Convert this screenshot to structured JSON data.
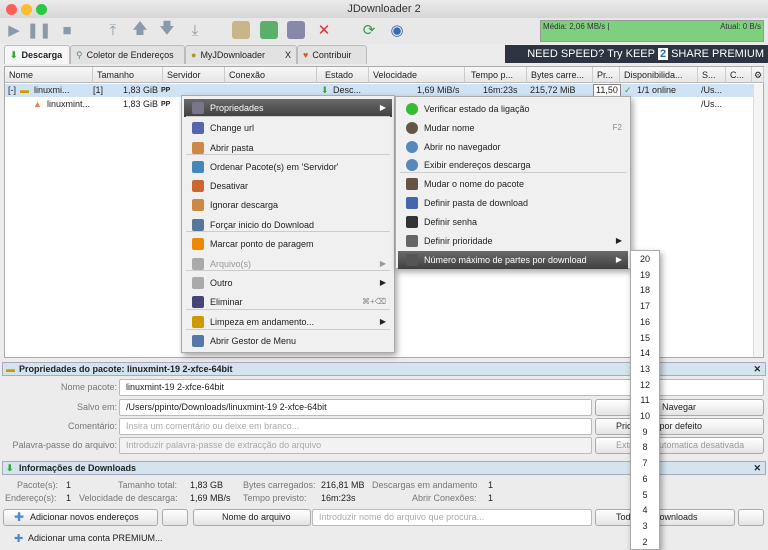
{
  "window": {
    "title": "JDownloader 2"
  },
  "speed": {
    "average": "Média: 2,06 MB/s |",
    "current": "Atual: 0 B/s"
  },
  "tabs": [
    {
      "label": "Descarga"
    },
    {
      "label": "Coletor de Endereços"
    },
    {
      "label": "MyJDownloader",
      "close": "X"
    },
    {
      "label": "Contribuir"
    }
  ],
  "promo": {
    "a": "NEED SPEED? Try KEEP",
    "b": "2",
    "c": "SHARE PREMIUM"
  },
  "table": {
    "headers": [
      "Nome",
      "Tamanho",
      "Servidor",
      "Conexão",
      "Estado",
      "Velocidade",
      "Tempo p...",
      "Bytes carre...",
      "Pr...",
      "Disponibilida...",
      "S...",
      "C..."
    ],
    "rows": [
      {
        "expander": "[-]",
        "name": "linuxmi...",
        "count": "[1]",
        "size": "1,83 GiB",
        "host": "PP",
        "status": "Desc...",
        "speed": "1,69 MiB/s",
        "eta": "16m:23s",
        "loaded": "215,72 MiB",
        "priority": "11,50",
        "availability": "1/1 online",
        "path": "/Us..."
      },
      {
        "name": "linuxmint...",
        "size": "1,83 GiB",
        "host": "PP",
        "path": "/Us..."
      }
    ]
  },
  "context_menu": {
    "items": [
      {
        "label": "Propriedades",
        "submenu": true
      },
      {
        "label": "Change url"
      },
      {
        "label": "Abrir pasta"
      },
      {
        "label": "Ordenar Pacote(s) em 'Servidor'"
      },
      {
        "label": "Desativar"
      },
      {
        "label": "Ignorar descarga"
      },
      {
        "label": "Forçar inicio do Download"
      },
      {
        "label": "Marcar ponto de paragem"
      },
      {
        "label": "Arquivo(s)",
        "submenu": true
      },
      {
        "label": "Outro",
        "submenu": true
      },
      {
        "label": "Eliminar",
        "shortcut": "⌘+⌫"
      },
      {
        "label": "Limpeza em andamento...",
        "submenu": true
      },
      {
        "label": "Abrir Gestor de Menu"
      }
    ]
  },
  "properties_submenu": {
    "items": [
      {
        "label": "Verificar estado da ligação"
      },
      {
        "label": "Mudar nome",
        "shortcut": "F2"
      },
      {
        "label": "Abrir no navegador"
      },
      {
        "label": "Exibir endereços descarga"
      },
      {
        "label": "Mudar o nome do pacote"
      },
      {
        "label": "Definir pasta de download"
      },
      {
        "label": "Definir senha"
      },
      {
        "label": "Definir prioridade"
      },
      {
        "label": "Número máximo de partes por download"
      }
    ]
  },
  "chunks_submenu": {
    "items": [
      "20",
      "19",
      "18",
      "17",
      "16",
      "15",
      "14",
      "13",
      "12",
      "11",
      "10",
      "9",
      "8",
      "7",
      "6",
      "5",
      "4",
      "3",
      "2"
    ]
  },
  "package_panel": {
    "title": "Propriedades do pacote: linuxmint-19 2-xfce-64bit",
    "name_label": "Nome pacote:",
    "name_value": "linuxmint-19 2-xfce-64bit",
    "saveto_label": "Salvo em:",
    "saveto_value": "/Users/ppinto/Downloads/linuxmint-19 2-xfce-64bit",
    "browse": "Navegar",
    "comment_label": "Comentário:",
    "comment_placeholder": "Insira um comentário ou deixe em branco...",
    "priority": "Prioridade por defeito",
    "password_label": "Palavra-passe do arquivo:",
    "password_placeholder": "Introduzir palavra-passe de extracção do arquivo",
    "extract": "Extração automatica desativada"
  },
  "info_panel": {
    "title": "Informações de Downloads",
    "packages_label": "Pacote(s):",
    "packages": "1",
    "total_label": "Tamanho total:",
    "total": "1,83 GB",
    "loaded_label": "Bytes carregados:",
    "loaded": "216,81 MB",
    "running_label": "Descargas em andamento",
    "running": "1",
    "links_label": "Endereço(s):",
    "links": "1",
    "speed_label": "Velocidade de descarga:",
    "speed": "1,69 MB/s",
    "eta_label": "Tempo previsto:",
    "eta": "16m:23s",
    "conn_label": "Abrir Conexões:",
    "conn": "1"
  },
  "bottom_bar": {
    "add_links": "Adicionar novos endereços",
    "search_field": "Nome do arquivo",
    "search_placeholder": "Introduzir nome do arquivo que procura...",
    "all_downloads": "Todos os downloads"
  },
  "status_bar": {
    "add_premium": "Adicionar uma conta PREMIUM..."
  }
}
